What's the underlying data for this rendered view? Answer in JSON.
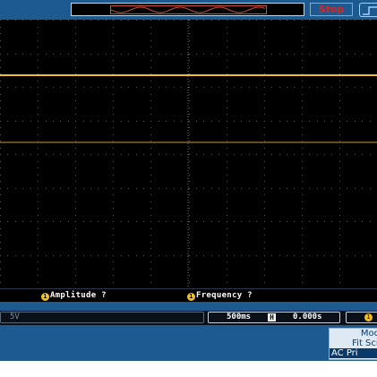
{
  "header": {
    "run_status": "Stop"
  },
  "measurements": {
    "amplitude_label": "Amplitude ?",
    "frequency_label": "Frequency ?",
    "channel_marker": "1"
  },
  "status": {
    "ch1_scale": "5V",
    "timebase": "500ms",
    "horizontal_icon": "H",
    "delay": "0.000s",
    "trigger_channel": "1"
  },
  "softkeys": {
    "key1_line1": "Mod",
    "key1_line2": "Fit Scr",
    "key1_line3": "AC Pri"
  },
  "colors": {
    "channel1": "#f0c020",
    "stop": "#e0241c",
    "frame": "#1c5a8f"
  },
  "icons": {
    "trigger_marker": "triangle-down-icon",
    "trigger_edge": "rising-edge-icon"
  }
}
